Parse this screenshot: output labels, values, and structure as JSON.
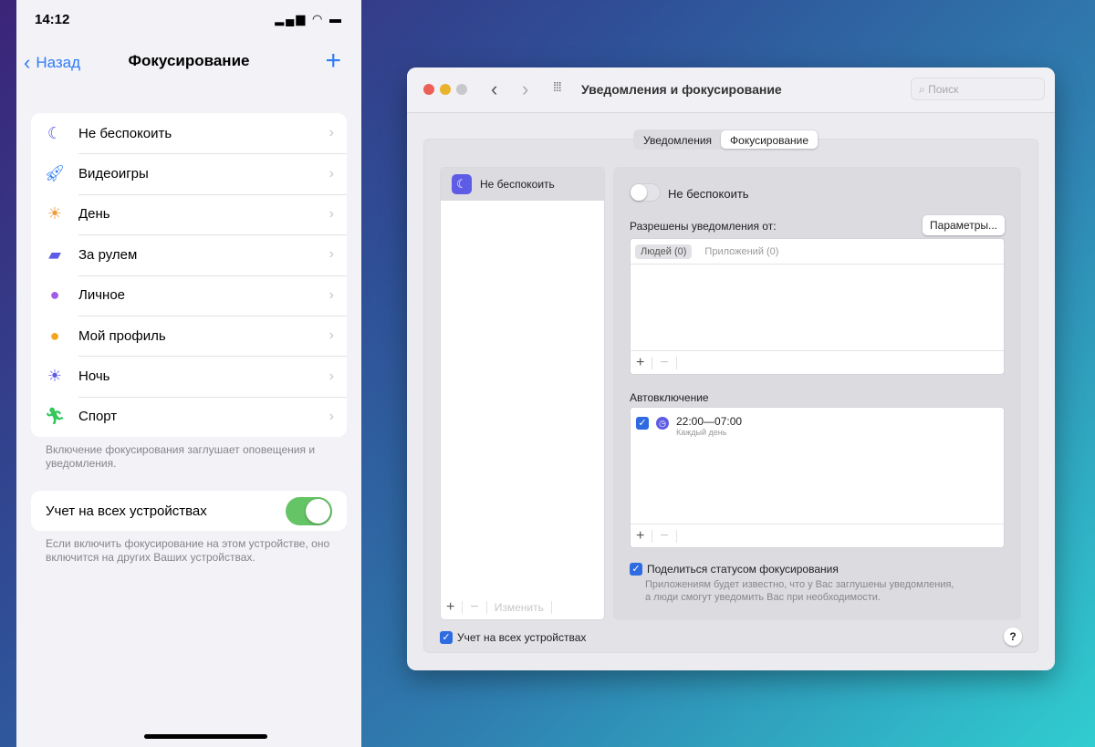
{
  "phone": {
    "status": {
      "time": "14:12",
      "icons": [
        "location-icon",
        "signal-icon",
        "wifi-icon",
        "battery-icon"
      ]
    },
    "nav": {
      "back": "Назад",
      "title": "Фокусирование",
      "add": "+"
    },
    "focus_items": [
      {
        "label": "Не беспокоить",
        "icon": "moon-icon",
        "color": "#5e5ce6"
      },
      {
        "label": "Видеоигры",
        "icon": "rocket-icon",
        "color": "#2f7cf6"
      },
      {
        "label": "День",
        "icon": "sunrise-icon",
        "color": "#f19a38"
      },
      {
        "label": "За рулем",
        "icon": "car-icon",
        "color": "#5e5ce6"
      },
      {
        "label": "Личное",
        "icon": "person-icon",
        "color": "#a05ce6"
      },
      {
        "label": "Мой профиль",
        "icon": "lightbulb-icon",
        "color": "#f3a521"
      },
      {
        "label": "Ночь",
        "icon": "sunset-icon",
        "color": "#5e5ce6"
      },
      {
        "label": "Спорт",
        "icon": "running-icon",
        "color": "#34c759"
      }
    ],
    "focus_footer": "Включение фокусирования заглушает оповещения и уведомления.",
    "share_devices": {
      "label": "Учет на всех устройствах",
      "on": true
    },
    "share_footer": "Если включить фокусирование на этом устройстве, оно включится на других Ваших устройствах."
  },
  "mac": {
    "title": "Уведомления и фокусирование",
    "search_placeholder": "Поиск",
    "tabs": [
      "Уведомления",
      "Фокусирование"
    ],
    "active_tab": "Фокусирование",
    "focus_list": [
      {
        "label": "Не беспокоить"
      }
    ],
    "list_edit": "Изменить",
    "toggle_label": "Не беспокоить",
    "toggle_on": false,
    "allowed_label": "Разрешены уведомления от:",
    "params_button": "Параметры...",
    "allowed_tabs": [
      "Людей (0)",
      "Приложений (0)"
    ],
    "auto_label": "Автовключение",
    "schedule": {
      "time": "22:00—07:00",
      "days": "Каждый день",
      "checked": true
    },
    "share_status": {
      "label": "Поделиться статусом фокусирования",
      "desc1": "Приложениям будет известно, что у Вас заглушены уведомления,",
      "desc2": "а люди смогут уведомить Вас при необходимости.",
      "checked": true
    },
    "all_devices": {
      "label": "Учет на всех устройствах",
      "checked": true
    },
    "plus": "+",
    "minus": "−",
    "help": "?"
  }
}
